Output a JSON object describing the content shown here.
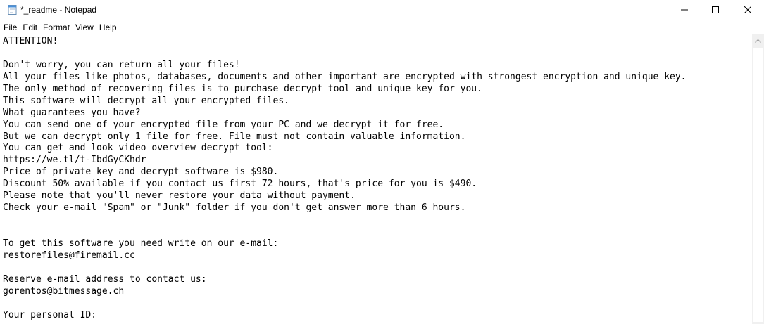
{
  "window": {
    "title": "*_readme - Notepad"
  },
  "menu": {
    "items": [
      "File",
      "Edit",
      "Format",
      "View",
      "Help"
    ]
  },
  "document": {
    "lines": [
      "ATTENTION!",
      "",
      "Don't worry, you can return all your files!",
      "All your files like photos, databases, documents and other important are encrypted with strongest encryption and unique key.",
      "The only method of recovering files is to purchase decrypt tool and unique key for you.",
      "This software will decrypt all your encrypted files.",
      "What guarantees you have?",
      "You can send one of your encrypted file from your PC and we decrypt it for free.",
      "But we can decrypt only 1 file for free. File must not contain valuable information.",
      "You can get and look video overview decrypt tool:",
      "https://we.tl/t-IbdGyCKhdr",
      "Price of private key and decrypt software is $980.",
      "Discount 50% available if you contact us first 72 hours, that's price for you is $490.",
      "Please note that you'll never restore your data without payment.",
      "Check your e-mail \"Spam\" or \"Junk\" folder if you don't get answer more than 6 hours.",
      "",
      "",
      "To get this software you need write on our e-mail:",
      "restorefiles@firemail.cc",
      "",
      "Reserve e-mail address to contact us:",
      "gorentos@bitmessage.ch",
      "",
      "Your personal ID:"
    ]
  },
  "icons": {
    "app": "notepad-icon",
    "minimize": "minimize-icon",
    "maximize": "maximize-icon",
    "close": "close-icon",
    "scroll_up": "chevron-up-icon"
  },
  "colors": {
    "scrollbar_track": "#f0f0f0",
    "text": "#000000"
  }
}
